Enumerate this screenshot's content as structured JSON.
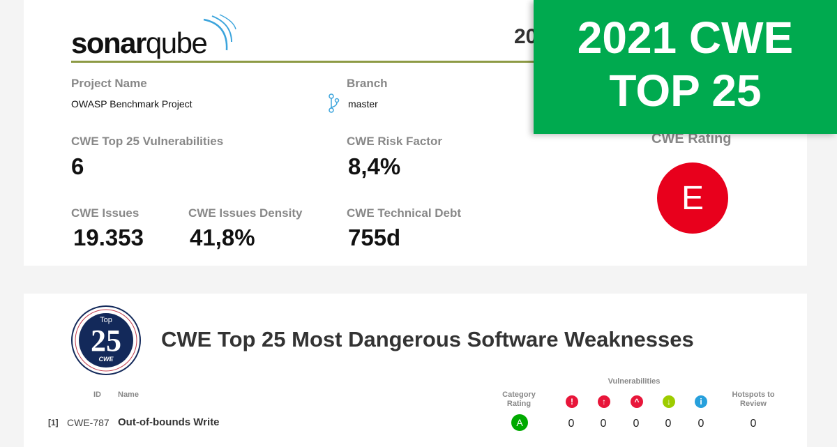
{
  "header": {
    "logo": "sonarqube",
    "year_partial": "20",
    "banner_line1": "2021 CWE",
    "banner_line2": "TOP 25"
  },
  "project": {
    "name_label": "Project Name",
    "name": "OWASP Benchmark Project",
    "branch_label": "Branch",
    "branch": "master"
  },
  "metrics": {
    "vuln_label": "CWE Top 25 Vulnerabilities",
    "vuln": "6",
    "risk_label": "CWE Risk Factor",
    "risk": "8,4%",
    "issues_label": "CWE Issues",
    "issues": "19.353",
    "density_label": "CWE Issues Density",
    "density": "41,8%",
    "debt_label": "CWE Technical Debt",
    "debt": "755d",
    "rating_label": "CWE Rating",
    "rating": "E",
    "rating_color": "#e8001c"
  },
  "section": {
    "badge_top": "Top",
    "badge_num": "25",
    "badge_bottom": "CWE",
    "title": "CWE Top 25 Most Dangerous Software Weaknesses"
  },
  "table": {
    "headers": {
      "id": "ID",
      "name": "Name",
      "category_rating": "Category Rating",
      "vulnerabilities": "Vulnerabilities",
      "hotspots": "Hotspots to Review"
    },
    "severity_icons": [
      "blocker-icon",
      "critical-icon",
      "major-icon",
      "minor-icon",
      "info-icon"
    ],
    "rows": [
      {
        "rank": "[1]",
        "id": "CWE-787",
        "name": "Out-of-bounds Write",
        "rating": "A",
        "blocker": "0",
        "critical": "0",
        "major": "0",
        "minor": "0",
        "info": "0",
        "hotspots": "0"
      }
    ]
  }
}
